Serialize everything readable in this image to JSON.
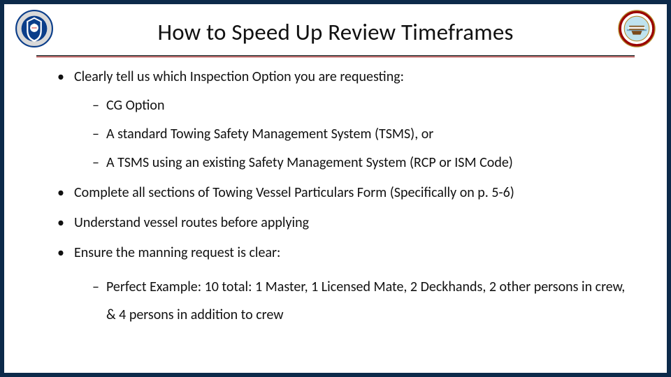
{
  "slide": {
    "title": "How to Speed Up Review Timeframes",
    "logos": {
      "left_alt": "dhs-seal",
      "right_alt": "uscg-sector-seal"
    },
    "bullets": [
      {
        "text": "Clearly tell us which Inspection Option you are requesting:",
        "sub": [
          "CG Option",
          "A standard Towing Safety Management System (TSMS), or",
          "A TSMS using an existing Safety Management System (RCP or ISM Code)"
        ]
      },
      {
        "text": "Complete all sections of Towing Vessel Particulars Form (Specifically on p. 5-6)",
        "sub": []
      },
      {
        "text": "Understand vessel routes before applying",
        "sub": []
      },
      {
        "text": "Ensure the manning request is clear:",
        "sub": [
          "Perfect Example: 10 total: 1 Master, 1 Licensed Mate, 2 Deckhands, 2 other persons in crew, & 4 persons in addition to crew"
        ]
      }
    ]
  }
}
